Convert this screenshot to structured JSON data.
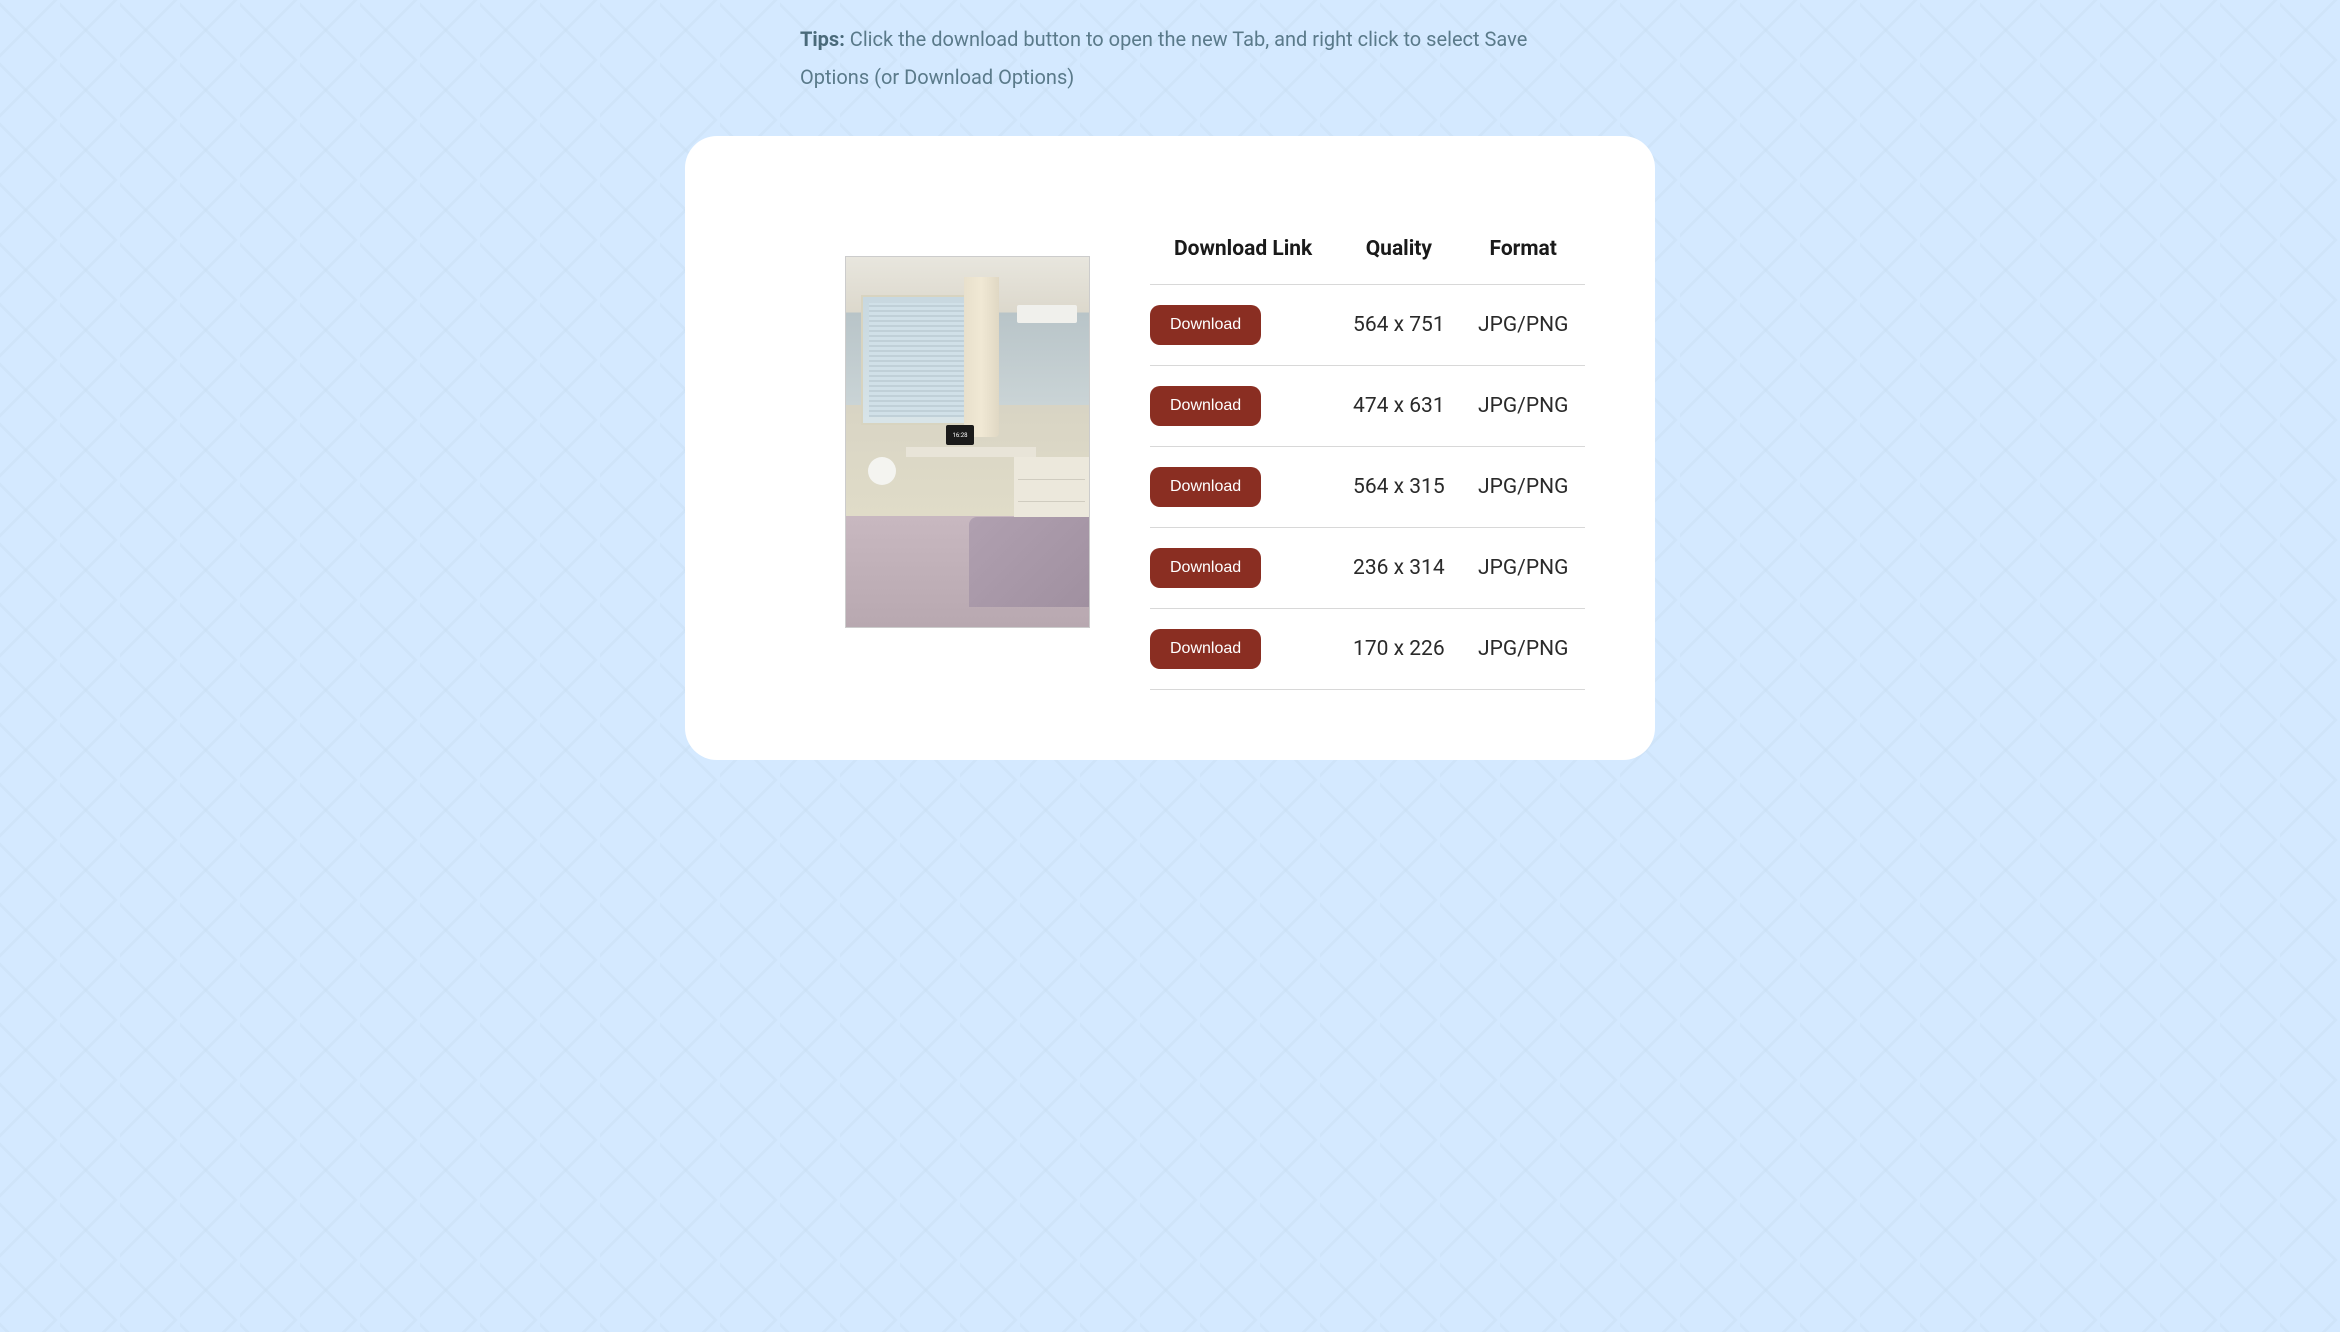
{
  "tips": {
    "label": "Tips:",
    "text": " Click the download button to open the new Tab, and right click to select Save Options (or Download Options)"
  },
  "preview": {
    "clock_text": "16:28"
  },
  "table": {
    "headers": {
      "link": "Download Link",
      "quality": "Quality",
      "format": "Format"
    },
    "button_label": "Download",
    "rows": [
      {
        "quality": "564 x 751",
        "format": "JPG/PNG"
      },
      {
        "quality": "474 x 631",
        "format": "JPG/PNG"
      },
      {
        "quality": "564 x 315",
        "format": "JPG/PNG"
      },
      {
        "quality": "236 x 314",
        "format": "JPG/PNG"
      },
      {
        "quality": "170 x 226",
        "format": "JPG/PNG"
      }
    ]
  },
  "colors": {
    "button_bg": "#8a2e22",
    "page_bg": "#d4e9ff"
  }
}
